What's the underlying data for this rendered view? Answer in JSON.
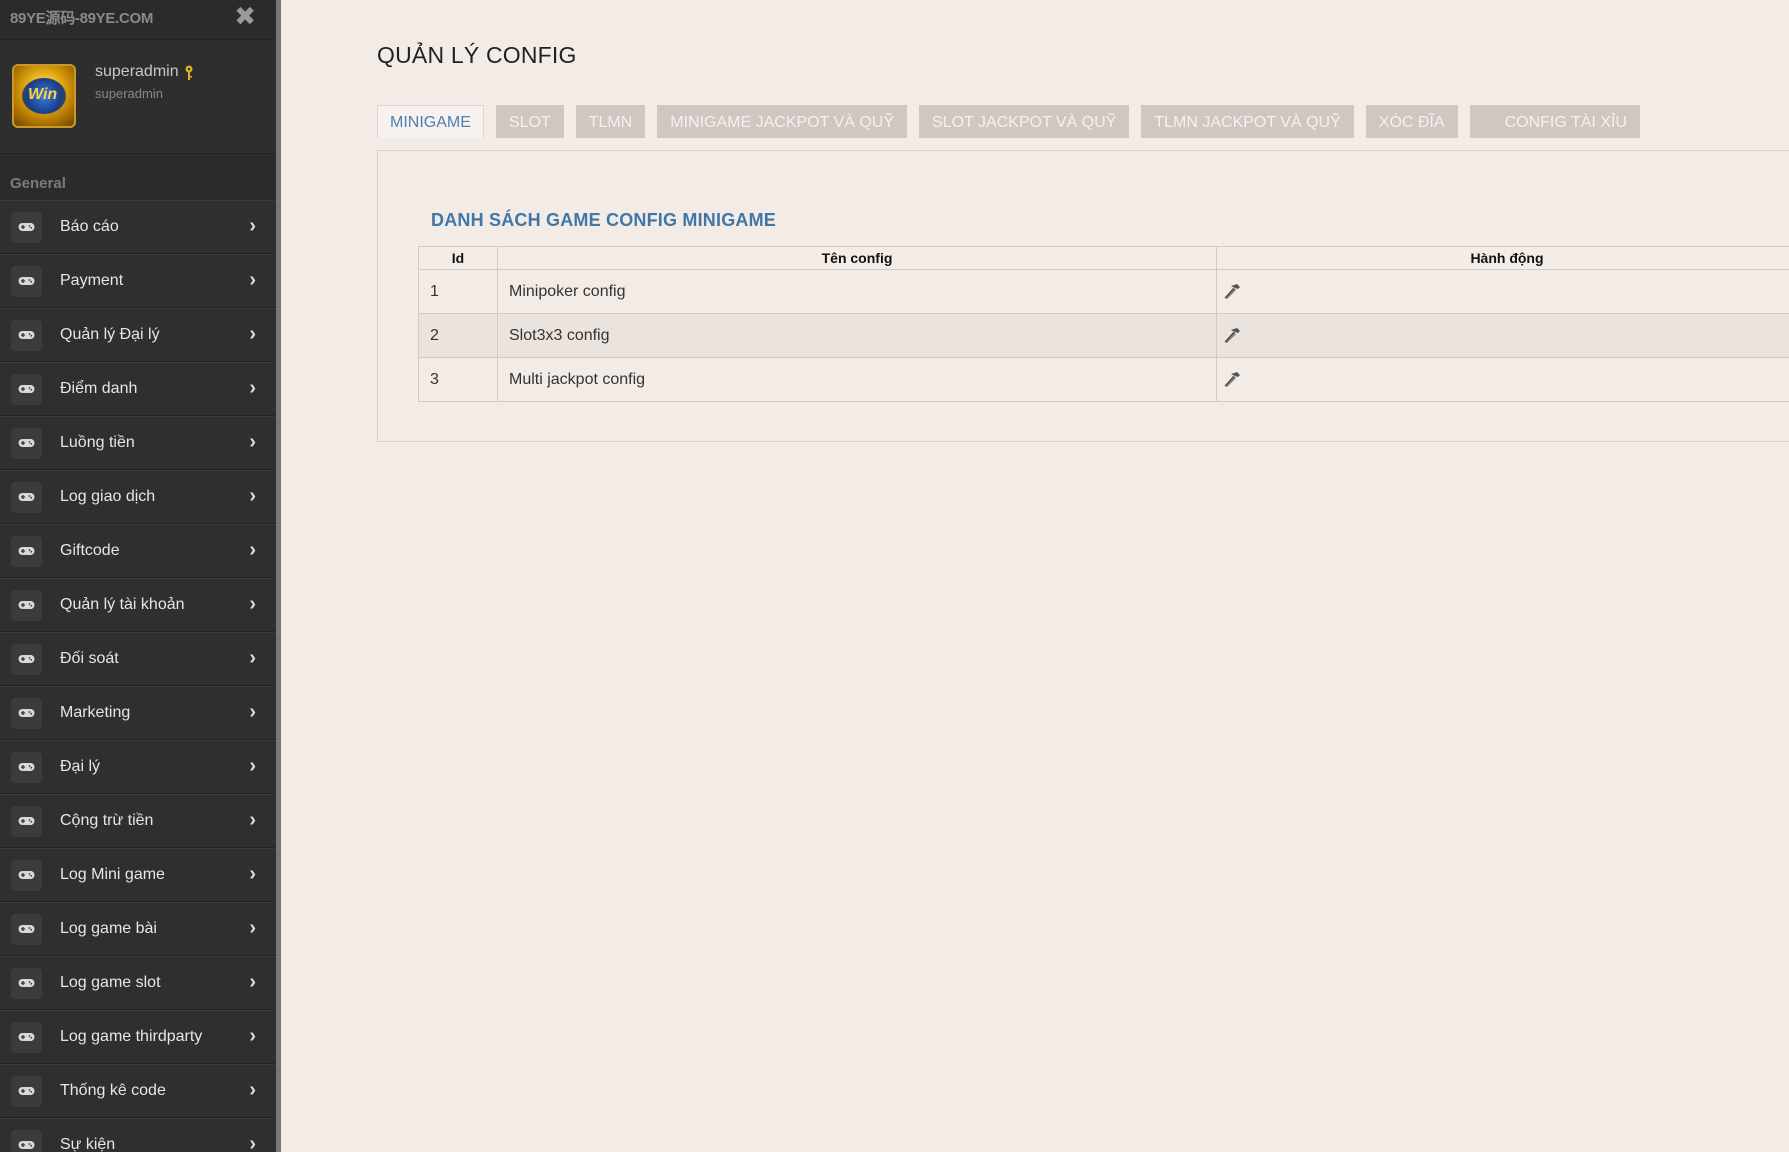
{
  "sidebar": {
    "brand": "89YE源码-89YE.COM",
    "close_icon": "close-icon",
    "user": {
      "name": "superadmin",
      "role": "superadmin",
      "avatar_text": "Win",
      "badge_icon": "key-icon"
    },
    "section_title": "General",
    "items": [
      {
        "label": "Báo cáo",
        "icon": "gamepad-icon"
      },
      {
        "label": "Payment",
        "icon": "gamepad-icon"
      },
      {
        "label": "Quản lý Đại lý",
        "icon": "gamepad-icon"
      },
      {
        "label": "Điểm danh",
        "icon": "gamepad-icon"
      },
      {
        "label": "Luồng tiền",
        "icon": "gamepad-icon"
      },
      {
        "label": "Log giao dịch",
        "icon": "gamepad-icon"
      },
      {
        "label": "Giftcode",
        "icon": "gamepad-icon"
      },
      {
        "label": "Quản lý tài khoản",
        "icon": "gamepad-icon"
      },
      {
        "label": "Đối soát",
        "icon": "gamepad-icon"
      },
      {
        "label": "Marketing",
        "icon": "gamepad-icon"
      },
      {
        "label": "Đại lý",
        "icon": "gamepad-icon"
      },
      {
        "label": "Cộng trừ tiền",
        "icon": "gamepad-icon"
      },
      {
        "label": "Log Mini game",
        "icon": "gamepad-icon"
      },
      {
        "label": "Log game bài",
        "icon": "gamepad-icon"
      },
      {
        "label": "Log game slot",
        "icon": "gamepad-icon"
      },
      {
        "label": "Log game thirdparty",
        "icon": "gamepad-icon"
      },
      {
        "label": "Thống kê code",
        "icon": "gamepad-icon"
      },
      {
        "label": "Sự kiện",
        "icon": "gamepad-icon"
      }
    ]
  },
  "main": {
    "title": "QUẢN LÝ CONFIG",
    "tabs": [
      {
        "label": "MINIGAME",
        "active": true
      },
      {
        "label": "SLOT",
        "active": false
      },
      {
        "label": "TLMN",
        "active": false
      },
      {
        "label": "MINIGAME JACKPOT VÀ QUỸ",
        "active": false
      },
      {
        "label": "SLOT JACKPOT VÀ QUỸ",
        "active": false
      },
      {
        "label": "TLMN JACKPOT VÀ QUỸ",
        "active": false
      },
      {
        "label": "XÓC ĐĨA",
        "active": false
      },
      {
        "label": "CONFIG TÀI XỈU",
        "active": false
      }
    ],
    "panel": {
      "title": "DANH SÁCH GAME CONFIG MINIGAME",
      "columns": [
        "Id",
        "Tên config",
        "Hành động"
      ],
      "rows": [
        {
          "id": "1",
          "name": "Minipoker config",
          "action_icon": "hammer-icon"
        },
        {
          "id": "2",
          "name": "Slot3x3 config",
          "action_icon": "hammer-icon"
        },
        {
          "id": "3",
          "name": "Multi jackpot config",
          "action_icon": "hammer-icon"
        }
      ]
    }
  },
  "colors": {
    "sidebar_bg": "#2b2b2b",
    "page_bg": "#f3ebe6",
    "accent": "#3f77a8",
    "tab_inactive": "#cfc7c2"
  }
}
